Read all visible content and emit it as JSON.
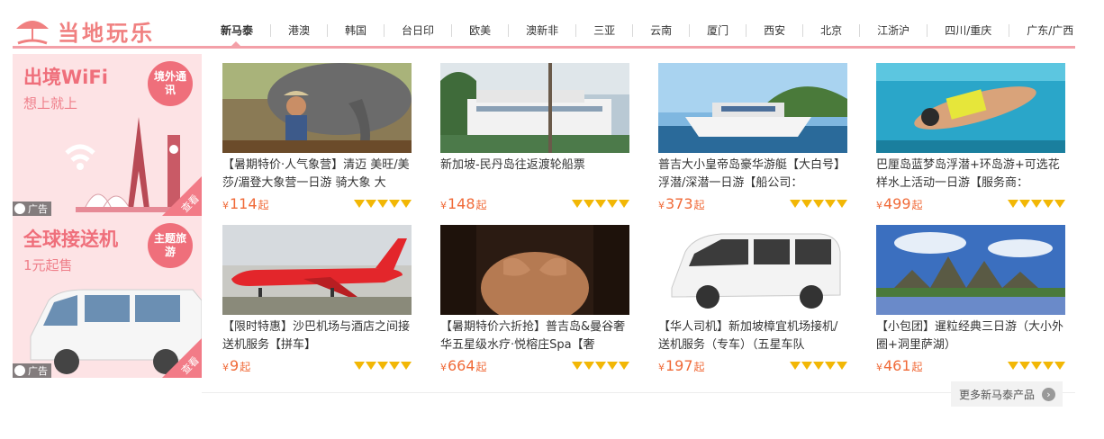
{
  "logo": {
    "text": "当地玩乐"
  },
  "nav": [
    "新马泰",
    "港澳",
    "韩国",
    "台日印",
    "欧美",
    "澳新非",
    "三亚",
    "云南",
    "厦门",
    "西安",
    "北京",
    "江浙沪",
    "四川/重庆",
    "广东/广西"
  ],
  "ads": [
    {
      "title": "出境WiFi",
      "subtitle": "想上就上",
      "badge": "境外通讯",
      "tag": "广告",
      "corner": "查看"
    },
    {
      "title": "全球接送机",
      "subtitle": "1元起售",
      "badge": "主题旅游",
      "tag": "广告",
      "corner": "查看"
    }
  ],
  "products": [
    {
      "title": "【暑期特价·人气象营】清迈 美旺/美莎/湄登大象营一日游 骑大象 大",
      "currency": "¥",
      "price": "114",
      "unit": "起"
    },
    {
      "title": "新加坡-民丹岛往返渡轮船票",
      "currency": "¥",
      "price": "148",
      "unit": "起"
    },
    {
      "title": "普吉大小皇帝岛豪华游艇【大白号】浮潜/深潜一日游【船公司：",
      "currency": "¥",
      "price": "373",
      "unit": "起"
    },
    {
      "title": "巴厘岛蓝梦岛浮潜+环岛游+可选花样水上活动一日游【服务商：",
      "currency": "¥",
      "price": "499",
      "unit": "起"
    },
    {
      "title": "【限时特惠】沙巴机场与酒店之间接送机服务【拼车】",
      "currency": "¥",
      "price": "9",
      "unit": "起"
    },
    {
      "title": "【暑期特价六折抢】普吉岛&曼谷奢华五星级水疗·悦榕庄Spa【奢",
      "currency": "¥",
      "price": "664",
      "unit": "起"
    },
    {
      "title": "【华人司机】新加坡樟宜机场接机/送机服务（专车）（五星车队",
      "currency": "¥",
      "price": "197",
      "unit": "起"
    },
    {
      "title": "【小包团】暹粒经典三日游（大小外圈+洞里萨湖）",
      "currency": "¥",
      "price": "461",
      "unit": "起"
    }
  ],
  "more": {
    "label": "更多新马泰产品"
  },
  "colors": {
    "accent": "#f3a0a8",
    "price": "#f06a38",
    "star": "#f2b705"
  }
}
